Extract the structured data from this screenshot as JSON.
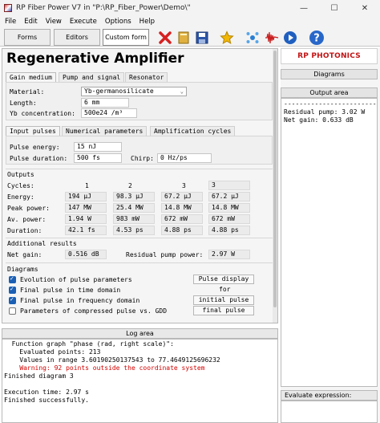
{
  "window": {
    "title": "RP Fiber Power V7 in \"P:\\RP_Fiber_Power\\Demo\\\"",
    "minimize": "—",
    "maximize": "☐",
    "close": "✕"
  },
  "menu": [
    "File",
    "Edit",
    "View",
    "Execute",
    "Options",
    "Help"
  ],
  "toolbar": {
    "forms": "Forms",
    "editors": "Editors",
    "custom_form": "Custom form",
    "icons": [
      "close-x-icon",
      "book-icon",
      "save-icon",
      "star-icon",
      "molecule-icon",
      "waveform-icon",
      "play-icon",
      "help-icon"
    ]
  },
  "form": {
    "title": "Regenerative Amplifier",
    "tabs_top": [
      "Gain medium",
      "Pump and signal",
      "Resonator"
    ],
    "material_label": "Material:",
    "material_value": "Yb-germanosilicate",
    "length_label": "Length:",
    "length_value": "6 mm",
    "yb_label": "Yb concentration:",
    "yb_value": "500e24 /m³",
    "tabs_mid": [
      "Input pulses",
      "Numerical parameters",
      "Amplification cycles"
    ],
    "pulse_energy_label": "Pulse energy:",
    "pulse_energy_value": "15 nJ",
    "pulse_duration_label": "Pulse duration:",
    "pulse_duration_value": "500 fs",
    "chirp_label": "Chirp:",
    "chirp_value": "0 Hz/ps",
    "outputs_heading": "Outputs",
    "cycles_label": "Cycles:",
    "cycles": [
      "1",
      "2",
      "3",
      "3"
    ],
    "energy_label": "Energy:",
    "energy": [
      "194 µJ",
      "98.3 µJ",
      "67.2 µJ",
      "67.2 µJ"
    ],
    "peak_label": "Peak power:",
    "peak": [
      "147 MW",
      "25.4 MW",
      "14.8 MW",
      "14.8 MW"
    ],
    "avg_label": "Av. power:",
    "avg": [
      "1.94 W",
      "983 mW",
      "672 mW",
      "672 mW"
    ],
    "duration_label": "Duration:",
    "duration": [
      "42.1 fs",
      "4.53 ps",
      "4.88 ps",
      "4.88 ps"
    ],
    "additional_heading": "Additional results",
    "net_gain_label": "Net gain:",
    "net_gain_value": "0.516 dB",
    "residual_label": "Residual pump power:",
    "residual_value": "2.97 W",
    "diagrams_heading": "Diagrams",
    "diagram_items": [
      {
        "label": "Evolution of pulse parameters",
        "checked": true
      },
      {
        "label": "Final pulse in time domain",
        "checked": true
      },
      {
        "label": "Final pulse in frequency domain",
        "checked": true
      },
      {
        "label": "Parameters of compressed pulse vs. GDD",
        "checked": false
      }
    ],
    "btn_pulse_display": "Pulse display",
    "for_label": "for",
    "btn_initial_pulse": "initial pulse",
    "btn_final_pulse": "final pulse"
  },
  "log": {
    "bar": "Log area",
    "lines": [
      {
        "text": "  Function graph \"phase (rad, right scale)\":",
        "red": false
      },
      {
        "text": "    Evaluated points: 213",
        "red": false
      },
      {
        "text": "    Values in range 3.60190250137543 to 77.4649125696232",
        "red": false
      },
      {
        "text": "    Warning: 92 points outside the coordinate system",
        "red": true
      },
      {
        "text": "Finished diagram 3",
        "red": false
      },
      {
        "text": "",
        "red": false
      },
      {
        "text": "Execution time: 2.97 s",
        "red": false
      },
      {
        "text": "Finished successfully.",
        "red": false
      }
    ]
  },
  "side": {
    "logo": "RP PHOTONICS",
    "diagrams_btn": "Diagrams",
    "output_head": "Output area",
    "output_lines": [
      "-------------------------",
      "Residual pump: 3.02 W",
      "Net gain: 0.633 dB"
    ],
    "eval_label": "Evaluate expression:"
  },
  "colors": {
    "brand_red": "#c11414",
    "check_blue": "#1a5fb4",
    "warning_red": "#d40000"
  }
}
